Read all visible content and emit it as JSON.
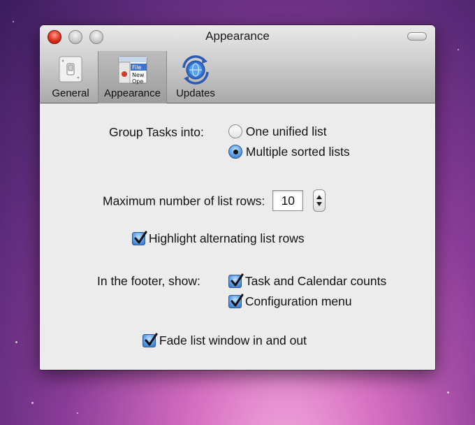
{
  "window": {
    "title": "Appearance"
  },
  "toolbar": {
    "items": [
      {
        "label": "General",
        "icon": "light-switch-icon",
        "selected": false
      },
      {
        "label": "Appearance",
        "icon": "list-window-icon",
        "selected": true
      },
      {
        "label": "Updates",
        "icon": "globe-sync-icon",
        "selected": false
      }
    ],
    "appearance_icon_text": [
      "File",
      "New",
      "Ope"
    ]
  },
  "settings": {
    "group_tasks_label": "Group Tasks into:",
    "group_options": [
      {
        "label": "One unified list",
        "selected": false
      },
      {
        "label": "Multiple sorted lists",
        "selected": true
      }
    ],
    "max_rows_label": "Maximum number of list rows:",
    "max_rows_value": "10",
    "highlight_label": "Highlight alternating list rows",
    "highlight_checked": true,
    "footer_label": "In the footer, show:",
    "footer_options": [
      {
        "label": "Task and Calendar counts",
        "checked": true
      },
      {
        "label": "Configuration menu",
        "checked": true
      }
    ],
    "fade_label": "Fade list window in and out",
    "fade_checked": true
  }
}
